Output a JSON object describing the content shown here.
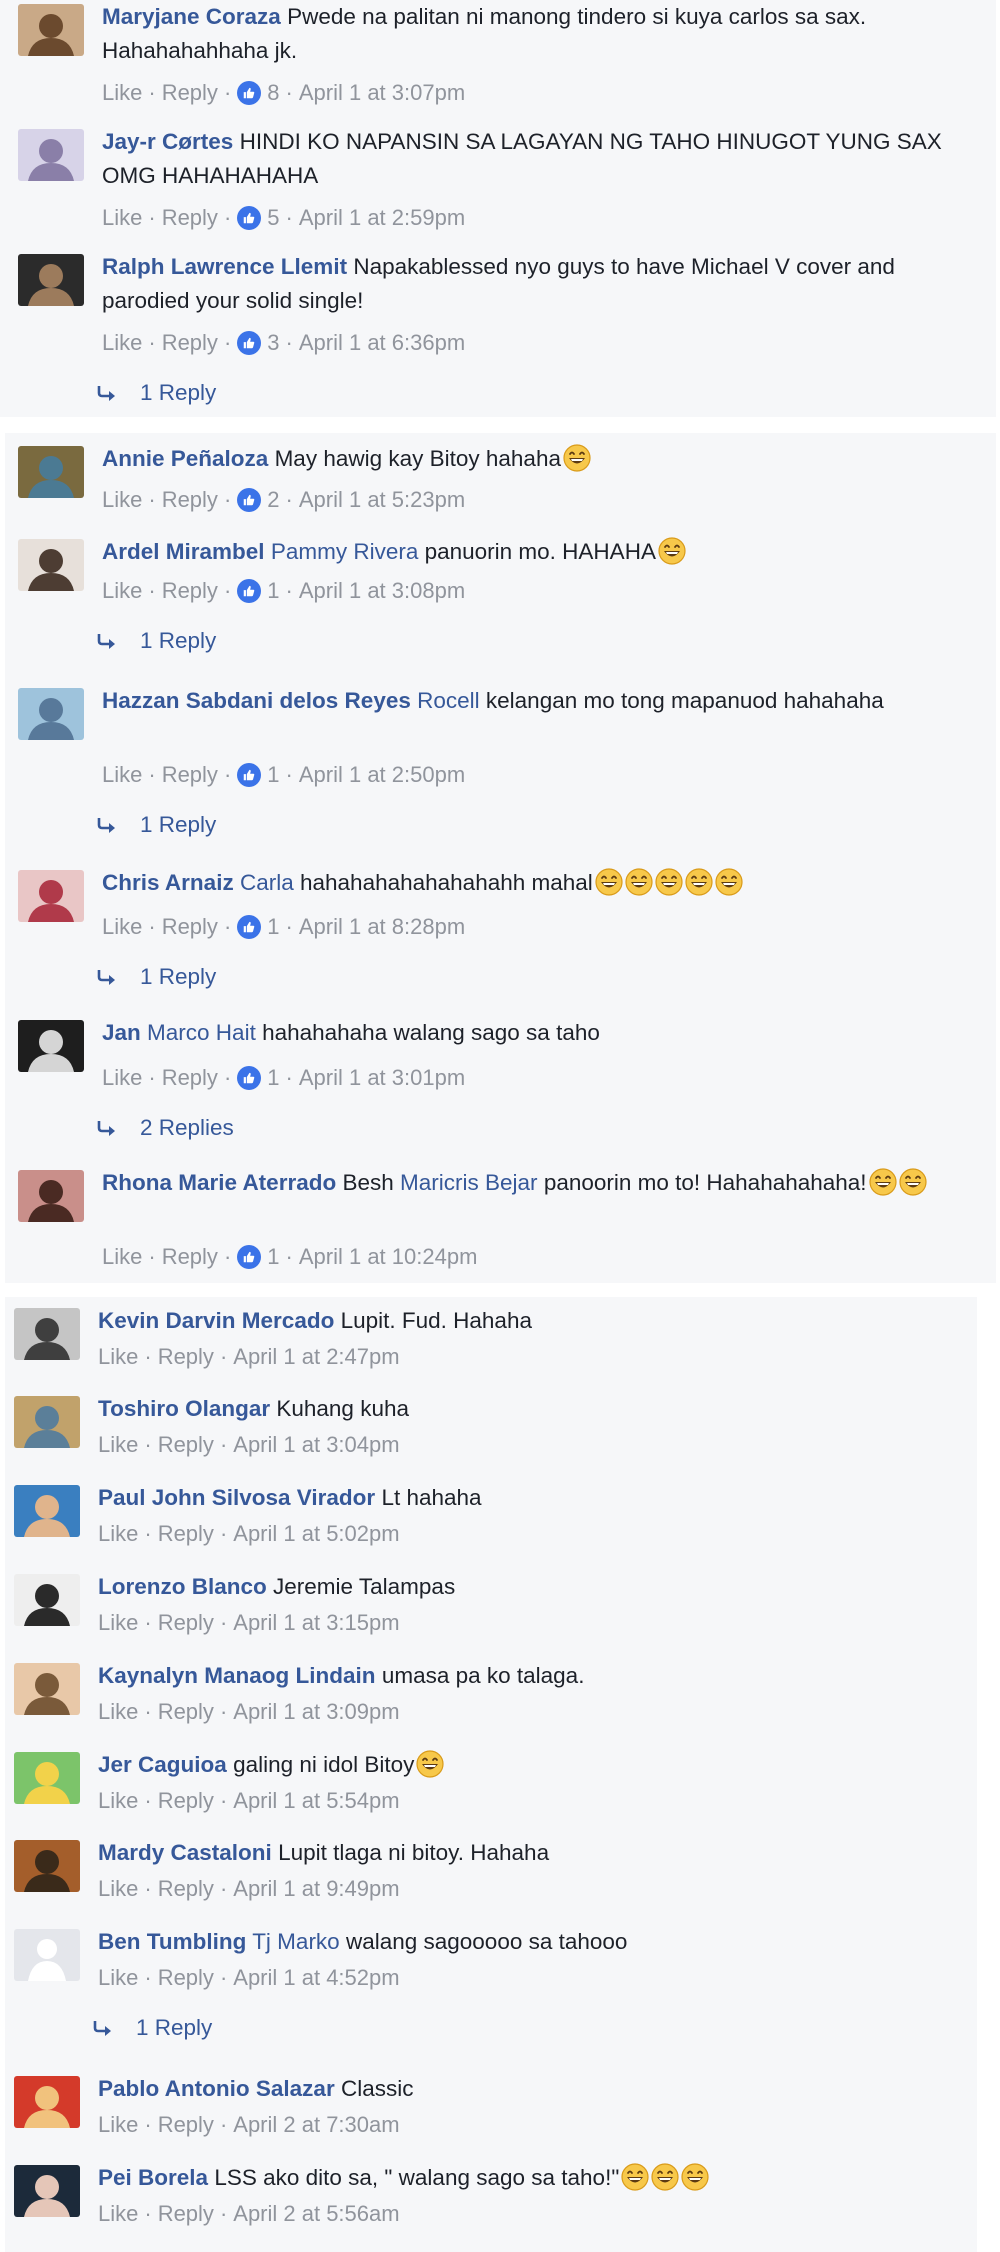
{
  "groups": [
    {
      "comments": [
        {
          "name": "Maryjane Coraza",
          "parts": [
            {
              "t": "Pwede na palitan ni manong tindero si kuya carlos sa sax. Hahahahahhaha jk."
            }
          ],
          "likes": "8",
          "time": "April 1 at 3:07pm"
        },
        {
          "name": "Jay-r Cørtes",
          "parts": [
            {
              "t": "HINDI KO NAPANSIN SA LAGAYAN NG TAHO HINUGOT YUNG SAX OMG HAHAHAHAHA"
            }
          ],
          "likes": "5",
          "time": "April 1 at 2:59pm"
        },
        {
          "name": "Ralph Lawrence Llemit",
          "parts": [
            {
              "t": "Napakablessed nyo guys to have Michael V cover and parodied your solid single!"
            }
          ],
          "likes": "3",
          "time": "April 1 at 6:36pm",
          "replies": "1 Reply"
        }
      ]
    },
    {
      "comments": [
        {
          "name": "Annie Peñaloza",
          "parts": [
            {
              "t": "May hawig kay Bitoy hahaha"
            }
          ],
          "emojis": 1,
          "likes": "2",
          "time": "April 1 at 5:23pm"
        },
        {
          "name": "Ardel Mirambel",
          "parts": [
            {
              "t": "Pammy Rivera",
              "m": true
            },
            {
              "t": " panuorin mo. HAHAHA"
            }
          ],
          "emojis": 1,
          "likes": "1",
          "time": "April 1 at 3:08pm",
          "replies": "1 Reply"
        },
        {
          "name": "Hazzan Sabdani delos Reyes",
          "parts": [
            {
              "t": "Rocell",
              "m": true
            },
            {
              "t": " kelangan mo tong mapanuod hahahaha"
            }
          ],
          "likes": "1",
          "time": "April 1 at 2:50pm",
          "replies": "1 Reply"
        },
        {
          "name": "Chris Arnaiz",
          "parts": [
            {
              "t": "Carla",
              "m": true
            },
            {
              "t": " hahahahahahahahahh mahal"
            }
          ],
          "emojis": 5,
          "likes": "1",
          "time": "April 1 at 8:28pm",
          "replies": "1 Reply"
        },
        {
          "name": "Jan",
          "parts": [
            {
              "t": "Marco Hait",
              "m": true
            },
            {
              "t": " hahahahaha walang sago sa taho"
            }
          ],
          "likes": "1",
          "time": "April 1 at 3:01pm",
          "replies": "2 Replies"
        },
        {
          "name": "Rhona Marie Aterrado",
          "parts": [
            {
              "t": "Besh "
            },
            {
              "t": "Maricris Bejar",
              "m": true
            },
            {
              "t": " panoorin mo to! Hahahahahaha!"
            }
          ],
          "emojis": 2,
          "likes": "1",
          "time": "April 1 at 10:24pm"
        }
      ]
    },
    {
      "comments": [
        {
          "name": "Kevin Darvin Mercado",
          "parts": [
            {
              "t": "Lupit. Fud. Hahaha"
            }
          ],
          "time": "April 1 at 2:47pm"
        },
        {
          "name": "Toshiro Olangar",
          "parts": [
            {
              "t": "Kuhang kuha"
            }
          ],
          "time": "April 1 at 3:04pm"
        },
        {
          "name": "Paul John Silvosa Virador",
          "parts": [
            {
              "t": "Lt hahaha"
            }
          ],
          "time": "April 1 at 5:02pm"
        },
        {
          "name": "Lorenzo Blanco",
          "parts": [
            {
              "t": "Jeremie Talampas"
            }
          ],
          "time": "April 1 at 3:15pm"
        },
        {
          "name": "Kaynalyn Manaog Lindain",
          "parts": [
            {
              "t": "umasa pa ko talaga."
            }
          ],
          "time": "April 1 at 3:09pm"
        },
        {
          "name": "Jer Caguioa",
          "parts": [
            {
              "t": "galing ni idol Bitoy"
            }
          ],
          "emojis": 1,
          "time": "April 1 at 5:54pm"
        },
        {
          "name": "Mardy Castaloni",
          "parts": [
            {
              "t": "Lupit tlaga ni bitoy. Hahaha"
            }
          ],
          "time": "April 1 at 9:49pm"
        },
        {
          "name": "Ben Tumbling",
          "parts": [
            {
              "t": "Tj Marko",
              "m": true
            },
            {
              "t": " walang sagooooo sa tahooo"
            }
          ],
          "time": "April 1 at 4:52pm",
          "replies": "1 Reply"
        },
        {
          "name": "Pablo Antonio Salazar",
          "parts": [
            {
              "t": "Classic"
            }
          ],
          "time": "April 2 at 7:30am"
        },
        {
          "name": "Pei Borela",
          "parts": [
            {
              "t": "LSS ako dito sa, \" walang sago sa taho!\""
            }
          ],
          "emojis": 3,
          "time": "April 2 at 5:56am"
        }
      ]
    }
  ],
  "labels": {
    "like": "Like",
    "reply": "Reply",
    "separator": "·"
  },
  "colors": {
    "name": "#365899",
    "meta": "#90949c",
    "like_badge": "#3b73e8",
    "panel": "#f6f7f9"
  },
  "icons": {
    "like": "thumbs-up-icon",
    "reply": "reply-arrow-icon",
    "emoji": "grinning-face-emoji"
  }
}
